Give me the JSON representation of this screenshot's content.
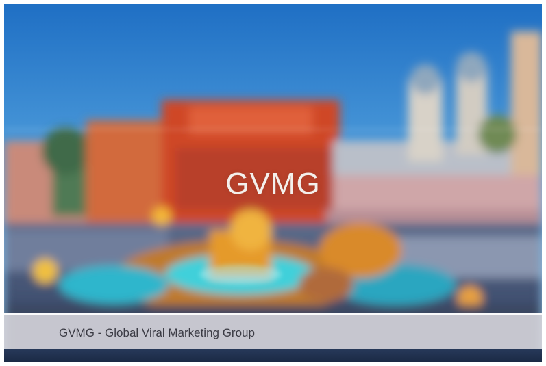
{
  "slide": {
    "title": "GVMG",
    "caption": "GVMG - Global Viral Marketing Group",
    "image": "blurred-city-square-photo"
  },
  "colors": {
    "sky_top": "#1f6fc4",
    "sky_bottom": "#8fc6ea",
    "building_red": "#d0482a",
    "fountain_cyan": "#35c2d2",
    "caption_bg": "#dad8de",
    "caption_text": "#3b3b44"
  }
}
